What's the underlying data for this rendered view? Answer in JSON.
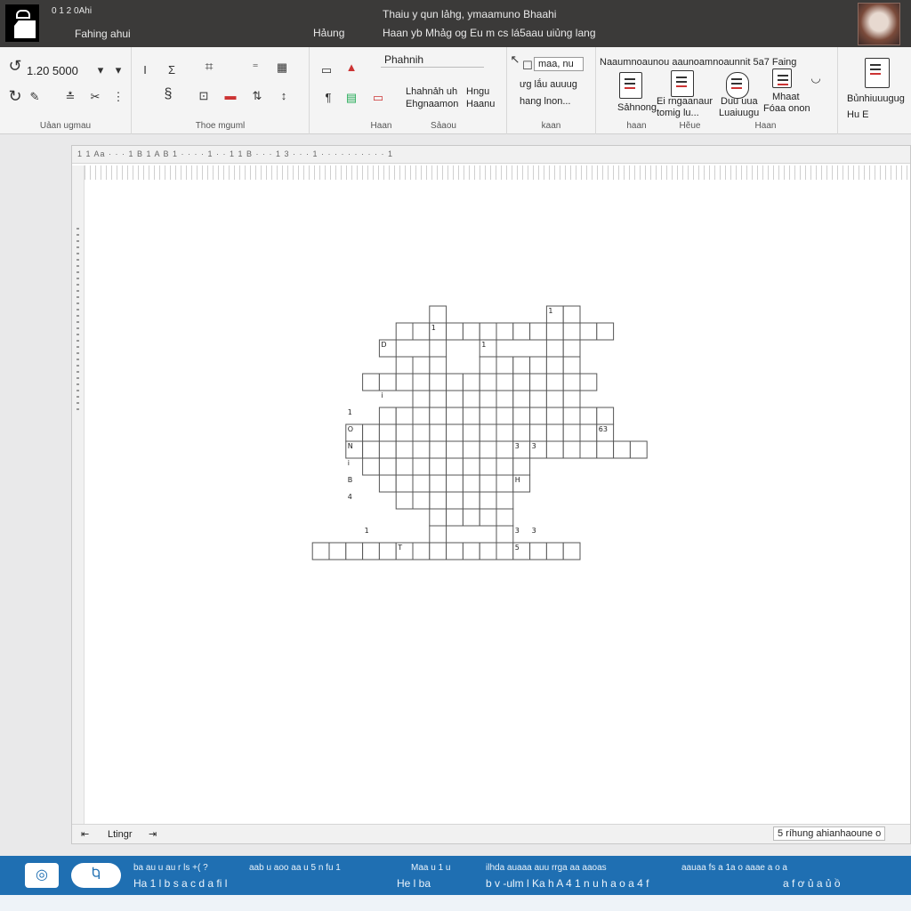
{
  "titlebar": {
    "left_small": "0 1 2 0Ahi",
    "file_name": "Fahing ahui",
    "document_title": "Thaiu y qun lảhg, ymaamuno Bhaahi",
    "tab_hong": "Hảung",
    "tab_line": "Haan yb Mhảg og Eu m cs lá5aau uiủng lang"
  },
  "ribbon": {
    "groups": [
      {
        "label": "Uảan ugmau"
      },
      {
        "label": "Thoe mguml"
      },
      {
        "label": "Haan"
      },
      {
        "label": "Sảaou"
      },
      {
        "label": "kaan"
      },
      {
        "label": "haan"
      },
      {
        "label": "Hẽue"
      },
      {
        "label": "Haan"
      }
    ],
    "font_size": "1.20 5000",
    "style_box": "Phahnih",
    "style_text_1": "Lhahnảh  uh",
    "style_text_2": "Ehgnaamon",
    "style_text_3": "Hngu",
    "style_text_4": "Haanu",
    "find_box": "maa, nu",
    "find_text_1": "ưg lắu auuug",
    "find_text_2": "hang lnon...",
    "insert_header": "Naaumnoaunou aaunoamnoaunnit 5a7 Faing",
    "insert_btn_1": "Sảhnong",
    "insert_btn_2": "Ei rngaanaur",
    "insert_btn_2b": "tomig lu...",
    "insert_btn_3": "Duu uua",
    "insert_btn_3b": "Luaiuugu",
    "insert_btn_4": "Mhaat",
    "insert_btn_4b": "Fóaa onon",
    "side_btn_1": "Bủnhiuuugug",
    "side_btn_2": "Hu E"
  },
  "document": {
    "toolbar_text": "1 1 Aa   · · · 1 B   1 A B 1 · · · · 1 · · 1 1  B  ·  ·  · 1  3  ·  ·  ·  1 · · · · · · · · · · 1",
    "status_left": "Ltingr",
    "status_right": "5 ríhung ahianhaoune o"
  },
  "crossword": {
    "cells": [
      [
        9,
        2
      ],
      [
        9,
        3
      ],
      [
        9,
        4
      ],
      [
        9,
        5
      ],
      [
        9,
        6
      ],
      [
        9,
        7
      ],
      [
        9,
        8
      ],
      [
        9,
        9
      ],
      [
        9,
        10
      ],
      [
        9,
        11
      ],
      [
        1,
        4
      ],
      [
        1,
        5
      ],
      [
        1,
        6
      ],
      [
        1,
        7
      ],
      [
        1,
        8
      ],
      [
        1,
        9
      ],
      [
        1,
        10
      ],
      [
        1,
        11
      ],
      [
        1,
        12
      ],
      [
        1,
        13
      ],
      [
        1,
        14
      ],
      [
        1,
        15
      ],
      [
        1,
        16
      ],
      [
        14,
        -1
      ],
      [
        14,
        0
      ],
      [
        14,
        1
      ],
      [
        14,
        2
      ],
      [
        14,
        3
      ],
      [
        14,
        4
      ],
      [
        14,
        5
      ],
      [
        14,
        6
      ],
      [
        14,
        7
      ],
      [
        14,
        8
      ],
      [
        14,
        9
      ],
      [
        14,
        10
      ],
      [
        14,
        11
      ],
      [
        14,
        12
      ],
      [
        14,
        13
      ],
      [
        14,
        14
      ],
      [
        4,
        2
      ],
      [
        4,
        3
      ],
      [
        4,
        4
      ],
      [
        4,
        5
      ],
      [
        4,
        6
      ],
      [
        4,
        7
      ],
      [
        4,
        8
      ],
      [
        4,
        9
      ],
      [
        4,
        10
      ],
      [
        4,
        11
      ],
      [
        4,
        12
      ],
      [
        4,
        13
      ],
      [
        4,
        14
      ],
      [
        4,
        15
      ],
      [
        6,
        3
      ],
      [
        6,
        4
      ],
      [
        6,
        5
      ],
      [
        6,
        6
      ],
      [
        6,
        7
      ],
      [
        6,
        8
      ],
      [
        6,
        9
      ],
      [
        6,
        10
      ],
      [
        6,
        11
      ],
      [
        6,
        12
      ],
      [
        6,
        13
      ],
      [
        6,
        14
      ],
      [
        6,
        15
      ],
      [
        6,
        16
      ],
      [
        0,
        6
      ],
      [
        1,
        6
      ],
      [
        2,
        6
      ],
      [
        3,
        6
      ],
      [
        5,
        6
      ],
      [
        6,
        6
      ],
      [
        7,
        6
      ],
      [
        8,
        6
      ],
      [
        9,
        6
      ],
      [
        10,
        6
      ],
      [
        11,
        6
      ],
      [
        12,
        6
      ],
      [
        13,
        6
      ],
      [
        5,
        5
      ],
      [
        5,
        7
      ],
      [
        5,
        8
      ],
      [
        5,
        9
      ],
      [
        5,
        10
      ],
      [
        5,
        11
      ],
      [
        5,
        12
      ],
      [
        5,
        13
      ],
      [
        5,
        14
      ],
      [
        7,
        1
      ],
      [
        7,
        2
      ],
      [
        7,
        3
      ],
      [
        7,
        4
      ],
      [
        7,
        5
      ],
      [
        7,
        7
      ],
      [
        7,
        8
      ],
      [
        7,
        9
      ],
      [
        7,
        10
      ],
      [
        7,
        11
      ],
      [
        7,
        12
      ],
      [
        7,
        13
      ],
      [
        7,
        14
      ],
      [
        7,
        15
      ],
      [
        7,
        16
      ],
      [
        8,
        1
      ],
      [
        8,
        2
      ],
      [
        8,
        3
      ],
      [
        8,
        4
      ],
      [
        8,
        5
      ],
      [
        8,
        6
      ],
      [
        8,
        7
      ],
      [
        8,
        8
      ],
      [
        8,
        9
      ],
      [
        8,
        10
      ],
      [
        8,
        11
      ],
      [
        8,
        12
      ],
      [
        8,
        13
      ],
      [
        8,
        14
      ],
      [
        8,
        15
      ],
      [
        8,
        16
      ],
      [
        8,
        17
      ],
      [
        8,
        18
      ],
      [
        10,
        3
      ],
      [
        10,
        4
      ],
      [
        10,
        5
      ],
      [
        10,
        6
      ],
      [
        10,
        7
      ],
      [
        10,
        8
      ],
      [
        10,
        9
      ],
      [
        10,
        10
      ],
      [
        10,
        11
      ],
      [
        11,
        4
      ],
      [
        11,
        5
      ],
      [
        11,
        6
      ],
      [
        11,
        7
      ],
      [
        11,
        8
      ],
      [
        11,
        9
      ],
      [
        11,
        10
      ],
      [
        12,
        7
      ],
      [
        12,
        8
      ],
      [
        12,
        9
      ],
      [
        12,
        10
      ],
      [
        13,
        10
      ],
      [
        2,
        9
      ],
      [
        3,
        9
      ],
      [
        3,
        10
      ],
      [
        3,
        11
      ],
      [
        3,
        12
      ],
      [
        3,
        13
      ],
      [
        2,
        3
      ],
      [
        3,
        4
      ],
      [
        3,
        5
      ],
      [
        0,
        13
      ],
      [
        0,
        14
      ],
      [
        2,
        13
      ],
      [
        2,
        14
      ],
      [
        3,
        14
      ]
    ],
    "numbers": [
      {
        "cell": [
          0,
          13
        ],
        "n": "1"
      },
      {
        "cell": [
          1,
          6
        ],
        "n": "1"
      },
      {
        "cell": [
          2,
          3
        ],
        "n": "D"
      },
      {
        "cell": [
          2,
          9
        ],
        "n": "1"
      },
      {
        "cell": [
          5,
          3
        ],
        "n": "i"
      },
      {
        "cell": [
          6,
          1
        ],
        "n": "1"
      },
      {
        "cell": [
          7,
          1
        ],
        "n": "O"
      },
      {
        "cell": [
          7,
          16
        ],
        "n": "63"
      },
      {
        "cell": [
          8,
          1
        ],
        "n": "N"
      },
      {
        "cell": [
          8,
          11
        ],
        "n": "3"
      },
      {
        "cell": [
          8,
          12
        ],
        "n": "3"
      },
      {
        "cell": [
          9,
          1
        ],
        "n": "i"
      },
      {
        "cell": [
          10,
          1
        ],
        "n": "B"
      },
      {
        "cell": [
          10,
          11
        ],
        "n": "H"
      },
      {
        "cell": [
          11,
          1
        ],
        "n": "4"
      },
      {
        "cell": [
          13,
          2
        ],
        "n": "1"
      },
      {
        "cell": [
          13,
          11
        ],
        "n": "3"
      },
      {
        "cell": [
          13,
          12
        ],
        "n": "3"
      },
      {
        "cell": [
          14,
          4
        ],
        "n": "T"
      },
      {
        "cell": [
          14,
          11
        ],
        "n": "5"
      }
    ]
  },
  "taskbar": {
    "icon_1": "◎",
    "icon_2": "Ⴉ",
    "row1_a": "ba au u au r ls +( ?",
    "row1_b": "aab u aoo aa u 5 n fu 1",
    "row1_c": "Maa u 1 u",
    "row1_d": "ilhda  auaaa auu rrga aa aaoas",
    "row1_e": "aauaa fs a   1a  o aaae a o a",
    "row2_a": "Ha  1  l  b  s  a  c  d  a  fi  l",
    "row2_b": "He   l  ba",
    "row2_c": "b  v  -ulm  l  Ka  h  A  4  1  n  u  h  a  o  a  4  f",
    "row2_d": "a  f  ơ  ủ  a  ủ  ồ",
    "colors": {
      "taskbar": "#1f6fb2",
      "titlebar": "#3b3a39"
    }
  }
}
